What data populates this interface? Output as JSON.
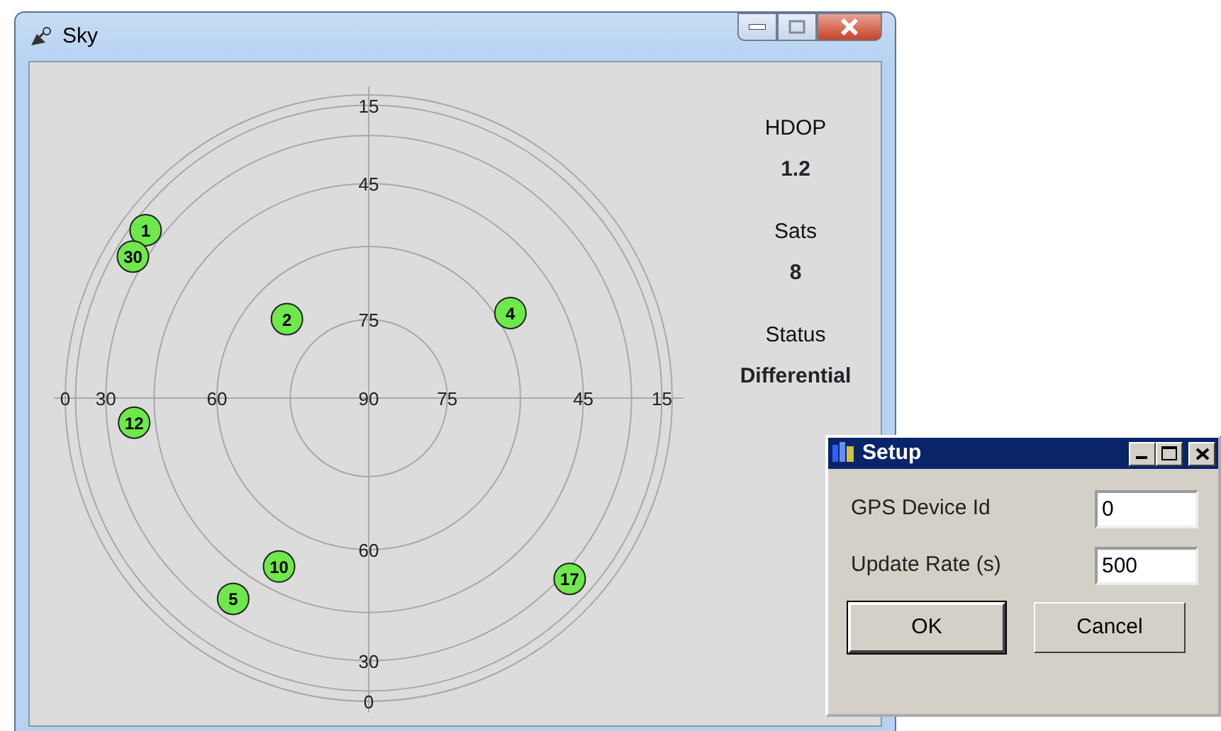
{
  "window": {
    "title": "Sky"
  },
  "sky_plot": {
    "satellites": [
      {
        "label": "1",
        "color": "#6ee84a"
      },
      {
        "label": "30",
        "color": "#6ee84a"
      },
      {
        "label": "2",
        "color": "#6ee84a"
      },
      {
        "label": "4",
        "color": "#6ee84a"
      },
      {
        "label": "12",
        "color": "#6ee84a"
      },
      {
        "label": "10",
        "color": "#6ee84a"
      },
      {
        "label": "5",
        "color": "#6ee84a"
      },
      {
        "label": "17",
        "color": "#6ee84a"
      }
    ],
    "axis_labels": [
      {
        "text": "15",
        "kind": "top"
      },
      {
        "text": "45",
        "kind": "top"
      },
      {
        "text": "75",
        "kind": "top"
      },
      {
        "text": "0",
        "kind": "left"
      },
      {
        "text": "30",
        "kind": "left"
      },
      {
        "text": "60",
        "kind": "left"
      },
      {
        "text": "90",
        "kind": "left"
      },
      {
        "text": "75",
        "kind": "right"
      },
      {
        "text": "45",
        "kind": "right"
      },
      {
        "text": "15",
        "kind": "right"
      },
      {
        "text": "60",
        "kind": "bottom"
      },
      {
        "text": "30",
        "kind": "bottom"
      },
      {
        "text": "0",
        "kind": "bottom"
      }
    ]
  },
  "stats": [
    {
      "label": "HDOP",
      "value": "1.2"
    },
    {
      "label": "Sats",
      "value": "8"
    },
    {
      "label": "Status",
      "value": "Differential"
    }
  ],
  "dialog": {
    "title": "Setup",
    "fields": [
      {
        "label": "GPS Device Id",
        "value": "0"
      },
      {
        "label": "Update Rate (s)",
        "value": "500"
      }
    ],
    "buttons": [
      {
        "label": "OK",
        "default": true
      },
      {
        "label": "Cancel",
        "default": false
      }
    ]
  }
}
